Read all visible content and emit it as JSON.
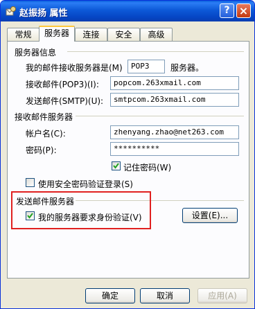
{
  "window": {
    "title": "赵振扬 属性",
    "help_label": "?",
    "close_label": "×"
  },
  "tabs": [
    "常规",
    "服务器",
    "连接",
    "安全",
    "高级"
  ],
  "server_info": {
    "group_label": "服务器信息",
    "incoming_type_label": "我的邮件接收服务器是(M)",
    "incoming_type_value": "POP3",
    "incoming_type_suffix": "服务器。",
    "pop3_label": "接收邮件(POP3)(I):",
    "pop3_value": "popcom.263xmail.com",
    "smtp_label": "发送邮件(SMTP)(U):",
    "smtp_value": "smtpcom.263xmail.com"
  },
  "incoming_server": {
    "group_label": "接收邮件服务器",
    "account_label": "帐户名(C):",
    "account_value": "zhenyang.zhao@net263.com",
    "password_label": "密码(P):",
    "password_value": "**********",
    "remember_label": "记住密码(W)",
    "remember_checked": true,
    "spa_label": "使用安全密码验证登录(S)",
    "spa_checked": false
  },
  "outgoing_server": {
    "group_label": "发送邮件服务器",
    "auth_label": "我的服务器要求身份验证(V)",
    "auth_checked": true,
    "settings_button": "设置(E)..."
  },
  "footer": {
    "ok": "确定",
    "cancel": "取消",
    "apply": "应用(A)"
  },
  "colors": {
    "titlebar": "#0a5fdc",
    "highlight_box": "#e0201f",
    "tab_accent": "#ffc83c"
  }
}
